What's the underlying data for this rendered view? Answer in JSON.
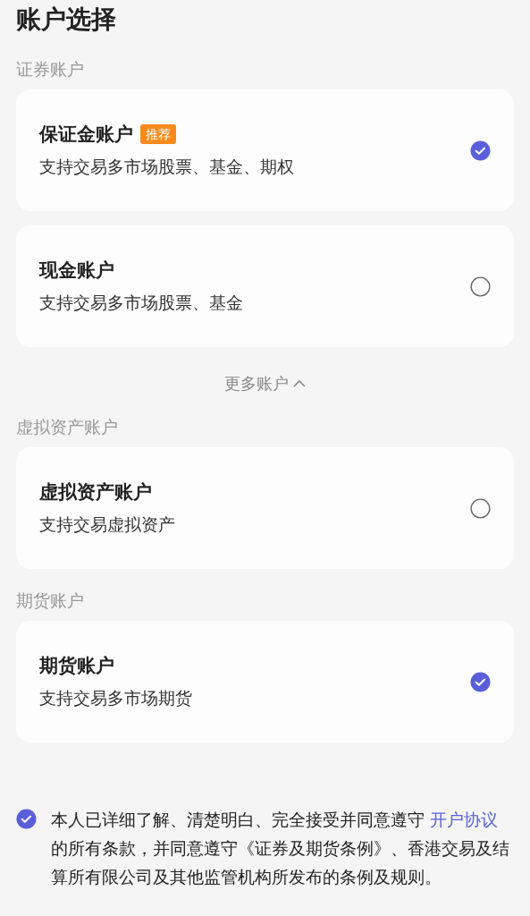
{
  "title": "账户选择",
  "sections": [
    {
      "label": "证券账户",
      "accounts": [
        {
          "name": "保证金账户",
          "tag": "推荐",
          "description": "支持交易多市场股票、基金、期权",
          "selected": true
        },
        {
          "name": "现金账户",
          "description": "支持交易多市场股票、基金",
          "selected": false
        }
      ],
      "more": {
        "label": "更多账户",
        "expanded": true
      }
    },
    {
      "label": "虚拟资产账户",
      "accounts": [
        {
          "name": "虚拟资产账户",
          "description": "支持交易虚拟资产",
          "selected": false
        }
      ]
    },
    {
      "label": "期货账户",
      "accounts": [
        {
          "name": "期货账户",
          "description": "支持交易多市场期货",
          "selected": true
        }
      ]
    }
  ],
  "agreement": {
    "checked": true,
    "text_before": "本人已详细了解、清楚明白、完全接受并同意遵守 ",
    "link": "开户协议",
    "text_after": "的所有条款，并同意遵守《证券及期货条例》、香港交易及结算所有限公司及其他监管机构所发布的条例及规则。"
  }
}
